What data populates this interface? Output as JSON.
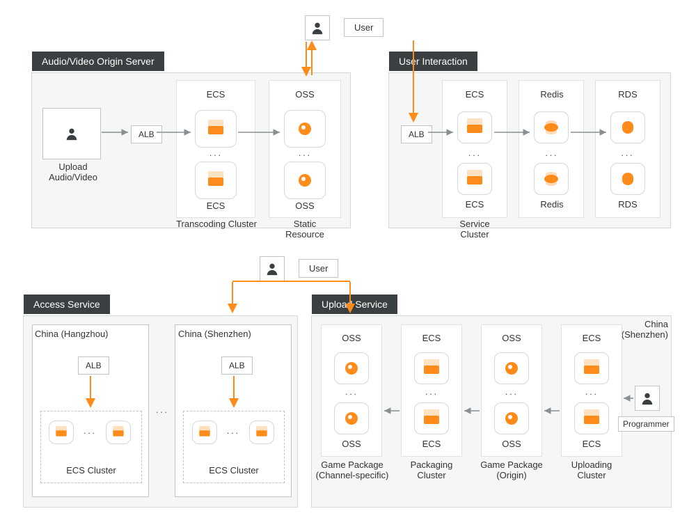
{
  "users": {
    "top": {
      "label": "User"
    },
    "mid": {
      "label": "User"
    },
    "programmer": {
      "label": "Programmer"
    }
  },
  "upload_av": {
    "label": "Upload\nAudio/Video"
  },
  "panels": {
    "origin": {
      "title": "Audio/Video Origin Server",
      "alb": "ALB",
      "cols": {
        "transcoding": {
          "label": "Transcoding Cluster",
          "top": "ECS",
          "bot": "ECS"
        },
        "static": {
          "label": "Static\nResource",
          "top": "OSS",
          "bot": "OSS"
        }
      }
    },
    "interaction": {
      "title": "User Interaction",
      "alb": "ALB",
      "cols": {
        "service": {
          "label": "Service\nCluster",
          "top": "ECS",
          "bot": "ECS"
        },
        "redis": {
          "top": "Redis",
          "bot": "Redis"
        },
        "rds": {
          "top": "RDS",
          "bot": "RDS"
        }
      }
    },
    "access": {
      "title": "Access Service",
      "regions": {
        "hz": {
          "label": "China (Hangzhou)",
          "alb": "ALB",
          "cluster": "ECS Cluster"
        },
        "sz": {
          "label": "China (Shenzhen)",
          "alb": "ALB",
          "cluster": "ECS Cluster"
        }
      }
    },
    "upload": {
      "title": "Upload Service",
      "region": "China\n(Shenzhen)",
      "cols": {
        "channel": {
          "label": "Game Package\n(Channel-specific)",
          "top": "OSS",
          "bot": "OSS"
        },
        "packaging": {
          "label": "Packaging\nCluster",
          "top": "ECS",
          "bot": "ECS"
        },
        "originpkg": {
          "label": "Game Package\n(Origin)",
          "top": "OSS",
          "bot": "OSS"
        },
        "uploading": {
          "label": "Uploading\nCluster",
          "top": "ECS",
          "bot": "ECS"
        }
      }
    }
  }
}
